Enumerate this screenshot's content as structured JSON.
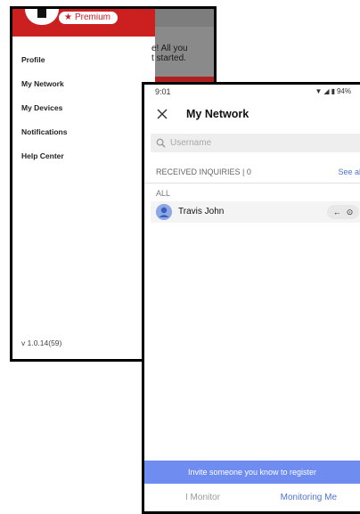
{
  "drawer": {
    "badge_label": "Premium",
    "menu_items": [
      {
        "label": "Profile"
      },
      {
        "label": "My Network"
      },
      {
        "label": "My Devices"
      },
      {
        "label": "Notifications"
      },
      {
        "label": "Help Center"
      }
    ],
    "peek_text_line1": "e! All you",
    "peek_text_line2": "t started.",
    "version": "v 1.0.14(59)"
  },
  "status_bar": {
    "time": "9:01",
    "battery": "94%"
  },
  "network": {
    "title": "My Network",
    "search_placeholder": "Username",
    "received_label": "RECEIVED INQUIRIES | 0",
    "see_all_label": "See all",
    "all_label": "ALL",
    "contacts": [
      {
        "name": "Travis John",
        "action_arrow": "←",
        "action_eye": "⊙"
      }
    ],
    "invite_label": "Invite someone you know to register",
    "tabs": {
      "monitor": "I Monitor",
      "monitoring_me": "Monitoring Me"
    }
  },
  "colors": {
    "brand_red": "#cc1f1f",
    "accent_blue": "#4f72d6",
    "invite_blue": "#6f8df0"
  }
}
